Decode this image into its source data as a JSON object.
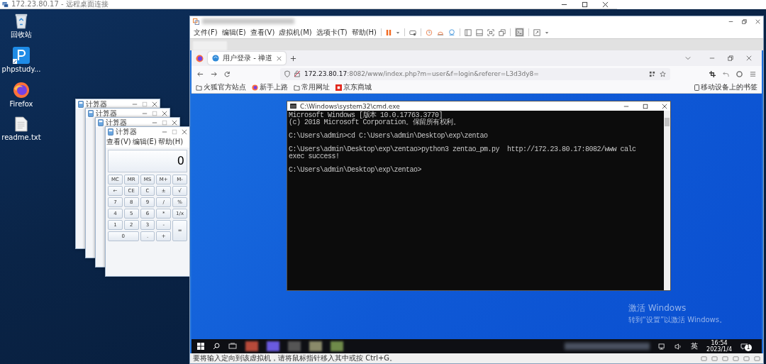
{
  "rdp_window": {
    "title": "172.23.80.17 - 远程桌面连接"
  },
  "desktop_icons": [
    {
      "kind": "recycle-bin",
      "label": "回收站"
    },
    {
      "kind": "phpstudy",
      "label": "phpstudy..."
    },
    {
      "kind": "firefox",
      "label": "Firefox"
    },
    {
      "kind": "text-file",
      "label": "readme.txt"
    }
  ],
  "calculators": [
    {
      "title": "计算器"
    },
    {
      "title": "计算器"
    },
    {
      "title": "计算器"
    },
    {
      "title": "计算器",
      "menu": [
        "查看(V)",
        "编辑(E)",
        "帮助(H)"
      ],
      "display": "0",
      "keys": [
        "MC",
        "MR",
        "MS",
        "M+",
        "M-",
        "←",
        "CE",
        "C",
        "±",
        "√",
        "7",
        "8",
        "9",
        "/",
        "%",
        "4",
        "5",
        "6",
        "*",
        "1/x",
        "1",
        "2",
        "3",
        "-",
        "=",
        "0",
        ".",
        "+"
      ]
    }
  ],
  "vmware": {
    "menu": [
      "文件(F)",
      "编辑(E)",
      "查看(V)",
      "虚拟机(M)",
      "选项卡(T)",
      "帮助(H)"
    ],
    "status_text": "要将输入定向到该虚拟机，请将鼠标指针移入其中或按 Ctrl+G。"
  },
  "firefox": {
    "tab": {
      "title": "用户登录 - 禅道"
    },
    "url": {
      "host": "172.23.80.17",
      "path": ":8082/www/index.php?m=user&f=login&referer=L3d3dy8="
    },
    "bookmarks": [
      {
        "kind": "folder",
        "label": "火狐官方站点"
      },
      {
        "kind": "firefox",
        "label": "新手上路"
      },
      {
        "kind": "folder",
        "label": "常用网址"
      },
      {
        "kind": "store",
        "label": "京东商城"
      }
    ],
    "mobile_bookmarks": "移动设备上的书签"
  },
  "cmd": {
    "title": "C:\\Windows\\system32\\cmd.exe",
    "blocks": [
      [
        "Microsoft Windows [版本 10.0.17763.3770]",
        "(c) 2018 Microsoft Corporation。保留所有权利。"
      ],
      [
        "C:\\Users\\admin>cd C:\\Users\\admin\\Desktop\\exp\\zentao"
      ],
      [
        "C:\\Users\\admin\\Desktop\\exp\\zentao>python3 zentao_pm.py  http://172.23.80.17:8082/www calc",
        "exec success!"
      ],
      [
        "C:\\Users\\admin\\Desktop\\exp\\zentao>"
      ]
    ]
  },
  "activation": {
    "title": "激活 Windows",
    "hint": "转到“设置”以激活 Windows。"
  },
  "taskbar": {
    "ime": "英",
    "time": "16:54",
    "date": "2023/1/4",
    "notifications": "1"
  }
}
